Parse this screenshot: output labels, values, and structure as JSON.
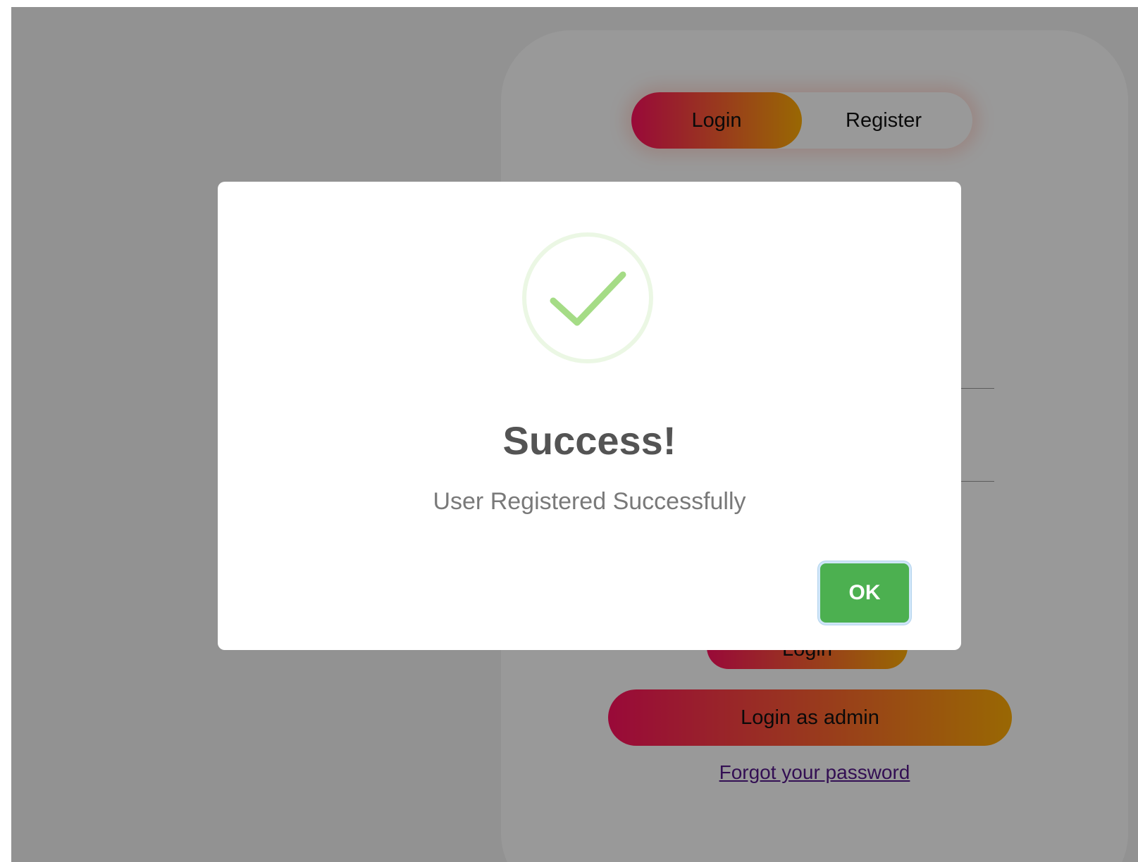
{
  "auth_card": {
    "tabs": [
      {
        "label": "Login",
        "active": true
      },
      {
        "label": "Register",
        "active": false
      }
    ],
    "login_button_label": "Login",
    "admin_button_label": "Login as admin",
    "forgot_link_label": "Forgot your password"
  },
  "modal": {
    "icon": "check-circle-icon",
    "title": "Success!",
    "message": "User Registered Successfully",
    "ok_label": "OK"
  },
  "colors": {
    "gradient_start": "#ff105f",
    "gradient_end": "#ffad06",
    "ok_button": "#4cb050",
    "check_stroke": "#a5dc86"
  }
}
